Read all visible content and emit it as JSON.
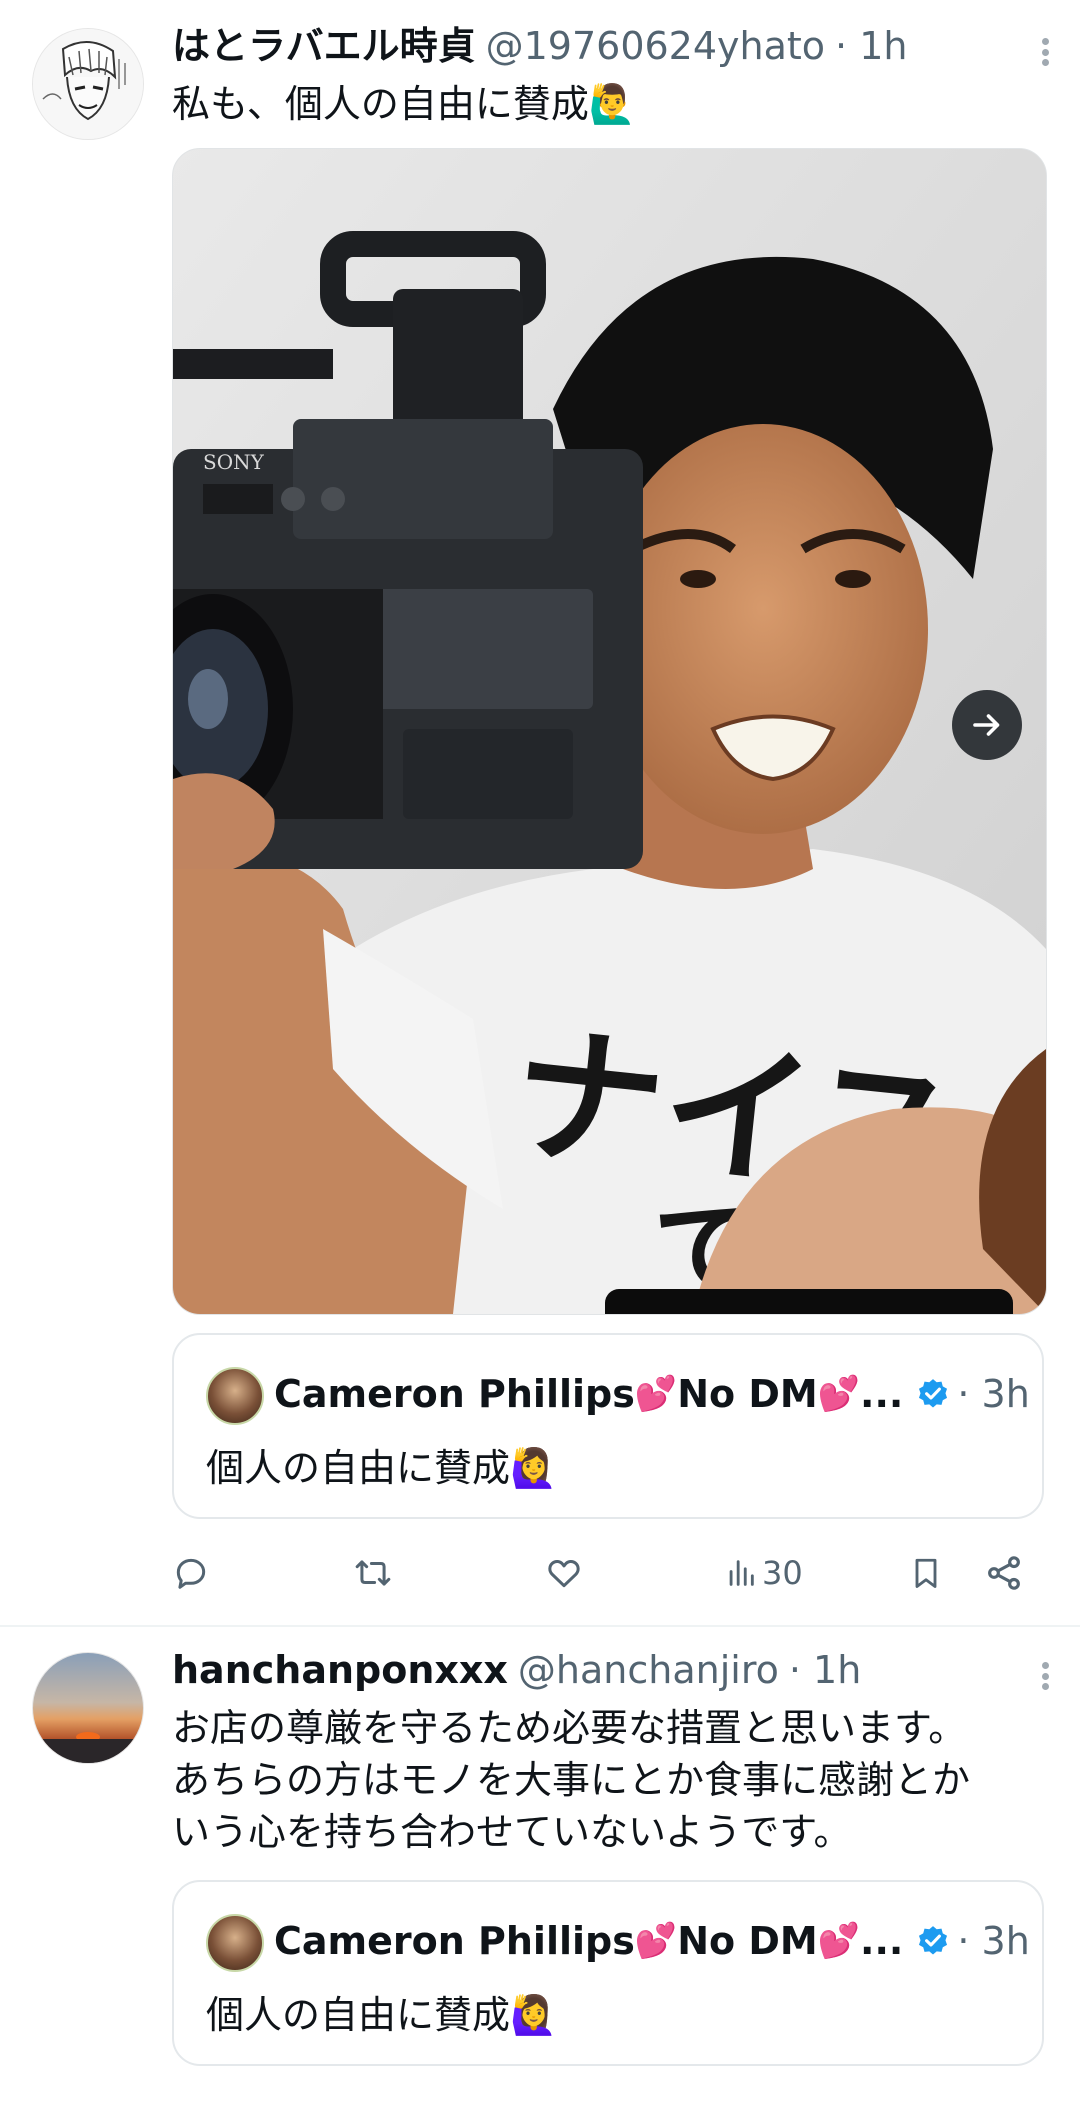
{
  "tweet1": {
    "author_name": "はとラバエル時貞",
    "handle": "@19760624yhato",
    "time": "· 1h",
    "text": "私も、個人の自由に賛成🙋‍♂️",
    "media_shirt_text": "ナイス",
    "media_shirt_text2": "で",
    "camera_brand": "SONY",
    "quote": {
      "author_name": "Cameron Phillips",
      "name_suffix": "No DM",
      "ellipsis": "...",
      "time": "· 3h",
      "text": "個人の自由に賛成🙋‍♀️"
    },
    "actions": {
      "views": "30"
    }
  },
  "tweet2": {
    "author_name": "hanchanponxxx",
    "handle": "@hanchanjiro",
    "time": "· 1h",
    "text_lines": [
      "お店の尊厳を守るため必要な措置と思います。",
      "あちらの方はモノを大事にとか食事に感謝とか",
      "いう心を持ち合わせていないようです。"
    ],
    "quote": {
      "author_name": "Cameron Phillips",
      "name_suffix": "No DM",
      "ellipsis": "...",
      "time": "· 3h",
      "text": "個人の自由に賛成🙋‍♀️"
    }
  },
  "colors": {
    "text_primary": "#0f1419",
    "text_secondary": "#536471",
    "verified_blue": "#1d9bf0",
    "heart_pink": "#e8479a",
    "border": "#e4e8eb"
  },
  "icons": [
    "reply-icon",
    "retweet-icon",
    "like-icon",
    "views-icon",
    "bookmark-icon",
    "share-icon",
    "more-icon",
    "verified-icon",
    "next-arrow-icon"
  ]
}
